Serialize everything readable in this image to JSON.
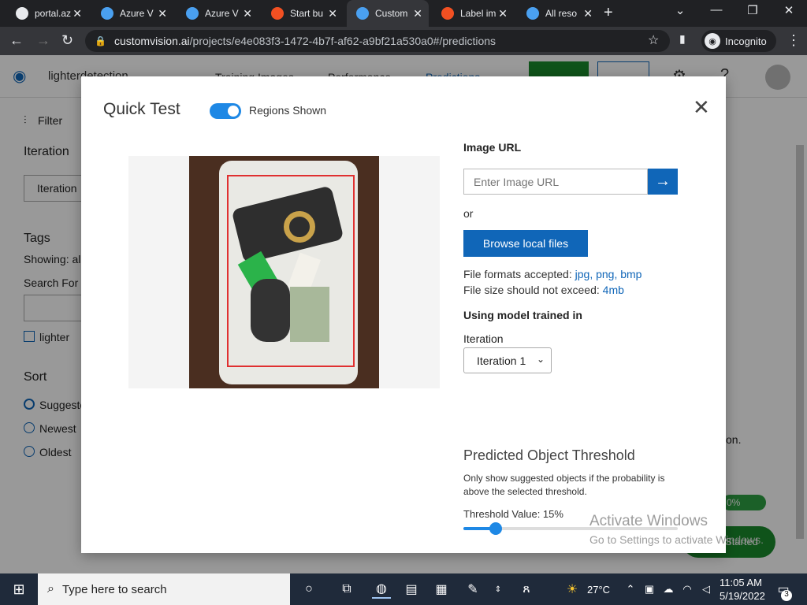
{
  "browser": {
    "tabs": [
      {
        "label": "portal.az",
        "icon": "github-icon",
        "color": "#e8eaed"
      },
      {
        "label": "Azure V",
        "icon": "azure-devops-icon",
        "color": "#4aa0f0"
      },
      {
        "label": "Azure V",
        "icon": "azure-devops-icon",
        "color": "#4aa0f0"
      },
      {
        "label": "Start bu",
        "icon": "microsoft-icon",
        "color": "#f25022"
      },
      {
        "label": "Custom",
        "icon": "customvision-icon",
        "color": "#4aa0f0"
      },
      {
        "label": "Label im",
        "icon": "microsoft-icon",
        "color": "#f25022"
      },
      {
        "label": "All reso",
        "icon": "azure-icon",
        "color": "#4aa0f0"
      }
    ],
    "url_host": "customvision.ai",
    "url_path": "/projects/e4e083f3-1472-4b7f-af62-a9bf21a530a0#/predictions",
    "incognito_label": "Incognito"
  },
  "app": {
    "project_name": "lighterdetection",
    "nav": [
      "Training Images",
      "Performance",
      "Predictions"
    ],
    "left": {
      "filter": "Filter",
      "iteration_heading": "Iteration",
      "iteration_value": "Iteration",
      "tags_heading": "Tags",
      "showing": "Showing: all",
      "search_for": "Search For T",
      "tag_lighter": "lighter",
      "sort_heading": "Sort",
      "sort_options": [
        "Suggested",
        "Newest",
        "Oldest"
      ]
    },
    "right_snippets": {
      "text_on": "on.",
      "progress": "0%",
      "started": "Started"
    }
  },
  "modal": {
    "title": "Quick Test",
    "regions_toggle_label": "Regions Shown",
    "regions_on": true,
    "image_url_label": "Image URL",
    "image_url_placeholder": "Enter Image URL",
    "or": "or",
    "browse_label": "Browse local files",
    "formats_prefix": "File formats accepted:",
    "formats": [
      "jpg",
      "png",
      "bmp"
    ],
    "size_prefix": "File size should not exceed:",
    "size_value": "4mb",
    "model_label": "Using model trained in",
    "iteration_label": "Iteration",
    "iteration_selected": "Iteration 1",
    "threshold_title": "Predicted Object Threshold",
    "threshold_desc": "Only show suggested objects if the probability is above the selected threshold.",
    "threshold_value_label": "Threshold Value: 15%",
    "threshold_fraction": 0.15
  },
  "watermark": {
    "line1": "Activate Windows",
    "line2": "Go to Settings to activate Windows."
  },
  "taskbar": {
    "search_placeholder": "Type here to search",
    "temperature": "27°C",
    "time": "11:05 AM",
    "date": "5/19/2022",
    "notification_count": "3"
  }
}
